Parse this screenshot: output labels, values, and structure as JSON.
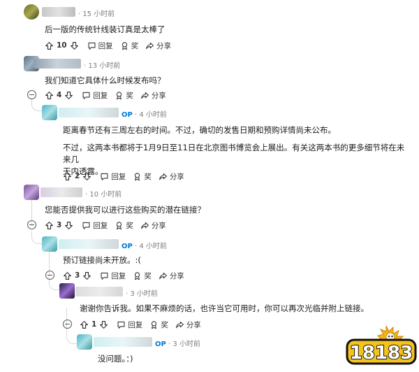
{
  "labels": {
    "reply": "回复",
    "award": "奖",
    "share": "分享",
    "op": "OP"
  },
  "comments": [
    {
      "time": "15 小时前",
      "text": "后一版的传统针线装订真是太棒了",
      "votes": "10"
    },
    {
      "time": "13 小时前",
      "text": "我们知道它具体什么时候发布吗？",
      "votes": "4"
    },
    {
      "time": "4 小时前",
      "op": true,
      "text_lines": [
        "距离春节还有三周左右的时间。不过，确切的发售日期和预购详情尚未公布。"
      ],
      "text_lines_b": [
        "不过，这两本书都将于1月9日至11日在北京图书博览会上展出。有关这两本书的更多细节将在未来几",
        "天内透露。"
      ],
      "votes": "2"
    },
    {
      "time": "10 小时前",
      "text": "您能否提供我可以进行这些购买的潜在链接？",
      "votes": "3"
    },
    {
      "time": "4 小时前",
      "op": true,
      "text": "预订链接尚未开放。:(",
      "votes": "3"
    },
    {
      "time": "3 小时前",
      "text": "谢谢你告诉我。如果不麻烦的话，也许当它可用时，你可以再次光临并附上链接。",
      "votes": "1"
    },
    {
      "time": "3 小时前",
      "op": true,
      "text": "没问题。：)"
    }
  ],
  "watermark": {
    "text": "18183"
  },
  "colors": {
    "op": "#0079d3",
    "meta": "#7c7c7c",
    "thread": "#d7d7d7"
  }
}
